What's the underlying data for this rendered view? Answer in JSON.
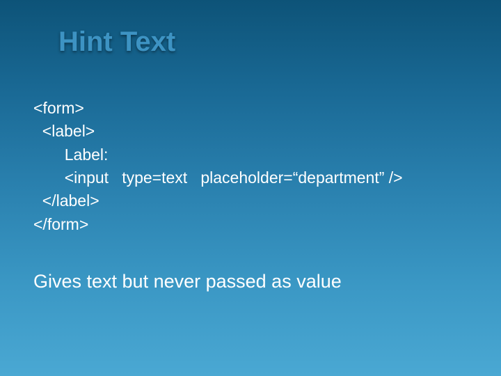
{
  "title": "Hint Text",
  "code": {
    "l1": "<form>",
    "l2": "  <label>",
    "l3": "       Label:",
    "l4": "       <input   type=text   placeholder=“department” />",
    "l5": "  </label>",
    "l6": "</form>"
  },
  "caption": "Gives text but never passed as value"
}
